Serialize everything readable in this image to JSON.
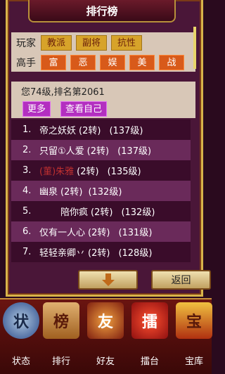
{
  "header": {
    "title": "排行榜"
  },
  "filters": {
    "row1_label": "玩家",
    "row1_buttons": [
      "教派",
      "副将",
      "抗性"
    ],
    "row2_label": "高手",
    "row2_buttons": [
      "富",
      "恶",
      "娱",
      "美",
      "战"
    ]
  },
  "info": {
    "status": "您74级,排名第2061",
    "more_label": "更多",
    "self_label": "查看自己"
  },
  "ranking": [
    {
      "num": "1.",
      "name": "帝之妖妖",
      "turn": "(2转)",
      "level": "(137级)"
    },
    {
      "num": "2.",
      "name": "只留①人爱",
      "turn": "(2转)",
      "level": "(137级)"
    },
    {
      "num": "3.",
      "name": "(菫)朱雅",
      "turn": "(2转)",
      "level": "(135级)"
    },
    {
      "num": "4.",
      "name": "幽泉",
      "turn": "(2转)",
      "level": "(132级)"
    },
    {
      "num": "5.",
      "name": "陪你疯",
      "turn": "(2转)",
      "level": "(132级)"
    },
    {
      "num": "6.",
      "name": "仅有一人心",
      "turn": "(2转)",
      "level": "(131级)"
    },
    {
      "num": "7.",
      "name": "轻轻亲卿丷",
      "turn": "(2转)",
      "level": "(128级)"
    }
  ],
  "actions": {
    "back_label": "返回"
  },
  "nav": [
    {
      "label": "状态",
      "icon": "状"
    },
    {
      "label": "排行",
      "icon": "榜"
    },
    {
      "label": "好友",
      "icon": "友"
    },
    {
      "label": "擂台",
      "icon": "擂"
    },
    {
      "label": "宝库",
      "icon": "宝"
    }
  ],
  "colors": {
    "accent_gold": "#d7a32a",
    "accent_orange": "#d85a1a",
    "accent_purple": "#b32fc0"
  }
}
